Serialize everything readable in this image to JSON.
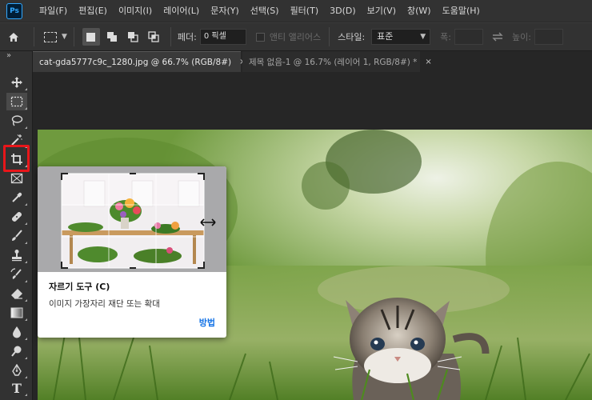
{
  "app": {
    "logo": "Ps"
  },
  "menu": [
    "파일(F)",
    "편집(E)",
    "이미지(I)",
    "레이어(L)",
    "문자(Y)",
    "선택(S)",
    "필터(T)",
    "3D(D)",
    "보기(V)",
    "창(W)",
    "도움말(H)"
  ],
  "options": {
    "feather_label": "페더:",
    "feather_value": "0 픽셀",
    "antialias_label": "앤티 앨리어스",
    "style_label": "스타일:",
    "style_value": "표준",
    "width_label": "폭:",
    "height_label": "높이:"
  },
  "tabs": [
    {
      "label": "cat-gda5777c9c_1280.jpg @ 66.7% (RGB/8#)",
      "close": "×"
    },
    {
      "label": "제목 없음-1 @ 16.7% (레이어 1, RGB/8#) *",
      "close": "×"
    }
  ],
  "toolbar": {
    "collapse": "»",
    "tools": [
      "move-icon",
      "rectangular-marquee-icon",
      "lasso-icon",
      "magic-wand-icon",
      "crop-icon",
      "frame-icon",
      "eyedropper-icon",
      "healing-brush-icon",
      "brush-icon",
      "clone-stamp-icon",
      "history-brush-icon",
      "eraser-icon",
      "gradient-icon",
      "blur-icon",
      "dodge-icon",
      "pen-icon",
      "type-icon"
    ],
    "type_glyph": "T"
  },
  "tooltip": {
    "title": "자르기 도구 (C)",
    "description": "이미지 가장자리 재단 또는 확대",
    "link": "방법"
  },
  "colors": {
    "accent": "#31a8ff",
    "highlight": "#e8161a",
    "link": "#1473e6"
  }
}
